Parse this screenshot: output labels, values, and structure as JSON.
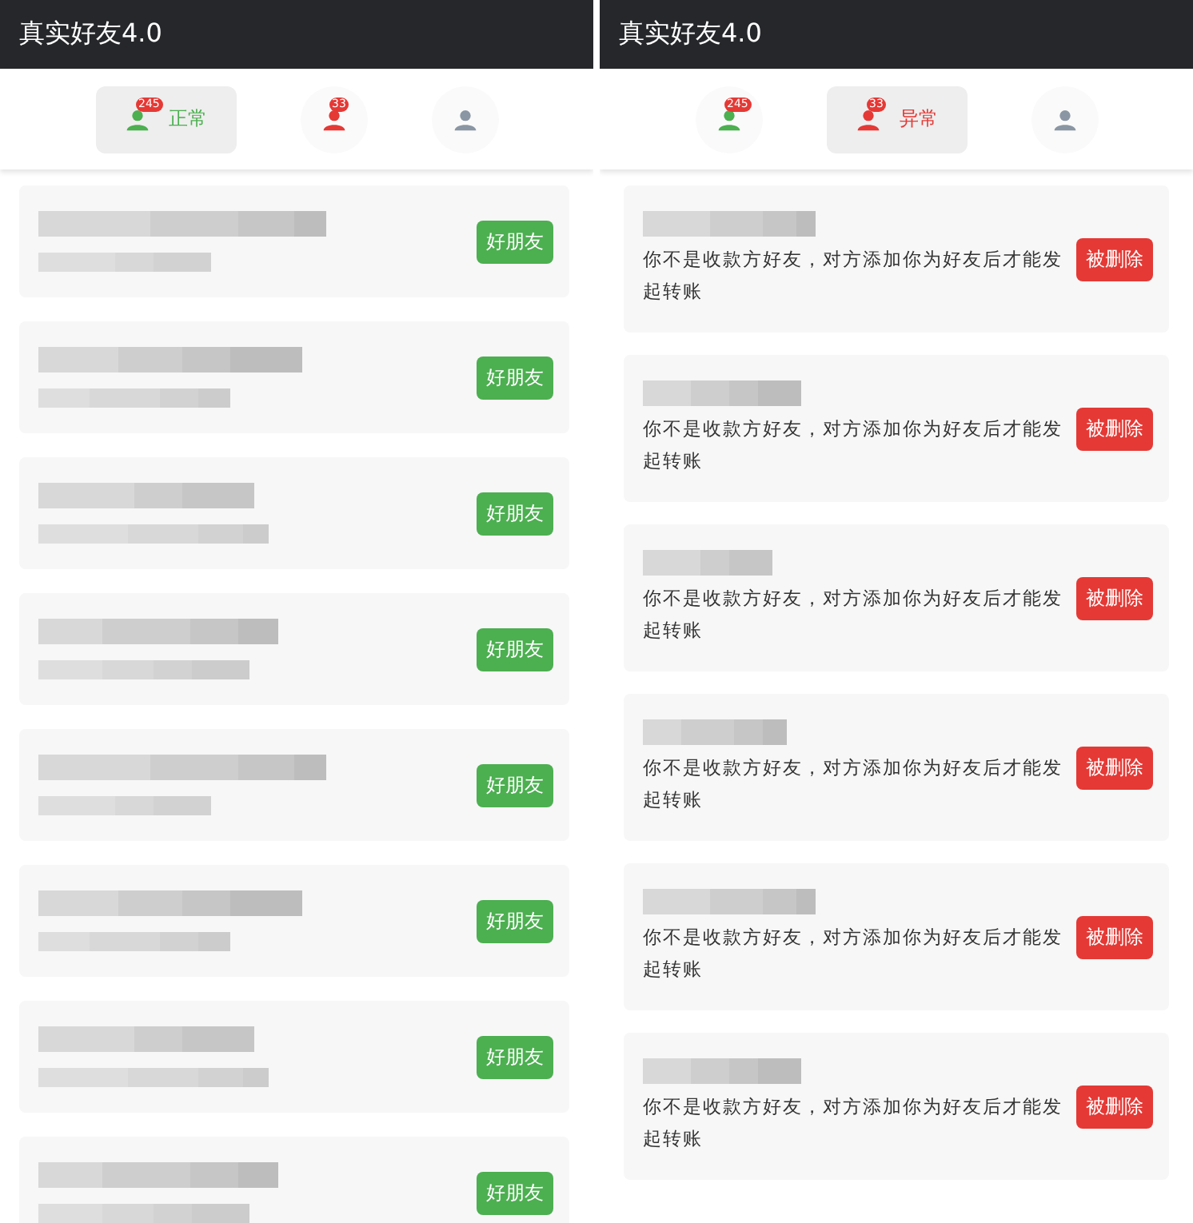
{
  "panels": [
    {
      "title": "真实好友4.0",
      "tabs": [
        {
          "kind": "normal",
          "badge": "245",
          "label": "正常",
          "selected": true
        },
        {
          "kind": "abnormal",
          "badge": "33",
          "selected": false
        },
        {
          "kind": "other",
          "selected": false
        }
      ],
      "items": [
        {
          "kind": "friend",
          "button": "好朋友"
        },
        {
          "kind": "friend",
          "button": "好朋友"
        },
        {
          "kind": "friend",
          "button": "好朋友"
        },
        {
          "kind": "friend",
          "button": "好朋友"
        },
        {
          "kind": "friend",
          "button": "好朋友"
        },
        {
          "kind": "friend",
          "button": "好朋友"
        },
        {
          "kind": "friend",
          "button": "好朋友"
        },
        {
          "kind": "friend",
          "button": "好朋友"
        }
      ]
    },
    {
      "title": "真实好友4.0",
      "tabs": [
        {
          "kind": "normal",
          "badge": "245",
          "selected": false
        },
        {
          "kind": "abnormal",
          "badge": "33",
          "label": "异常",
          "selected": true
        },
        {
          "kind": "other",
          "selected": false
        }
      ],
      "items": [
        {
          "kind": "deleted",
          "message": "你不是收款方好友，对方添加你为好友后才能发起转账",
          "button": "被删除"
        },
        {
          "kind": "deleted",
          "message": "你不是收款方好友，对方添加你为好友后才能发起转账",
          "button": "被删除"
        },
        {
          "kind": "deleted",
          "message": "你不是收款方好友，对方添加你为好友后才能发起转账",
          "button": "被删除"
        },
        {
          "kind": "deleted",
          "message": "你不是收款方好友，对方添加你为好友后才能发起转账",
          "button": "被删除"
        },
        {
          "kind": "deleted",
          "message": "你不是收款方好友，对方添加你为好友后才能发起转账",
          "button": "被删除"
        },
        {
          "kind": "deleted",
          "message": "你不是收款方好友，对方添加你为好友后才能发起转账",
          "button": "被删除"
        }
      ]
    }
  ]
}
